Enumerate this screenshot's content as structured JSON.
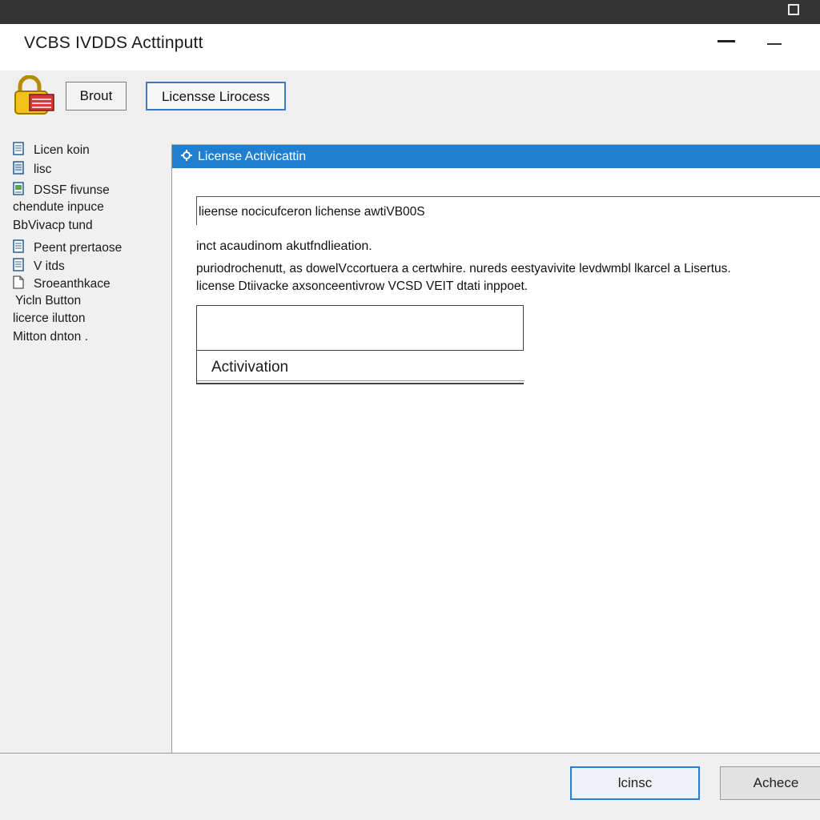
{
  "window": {
    "title": "VCBS IVDDS Acttinputt"
  },
  "toolbar": {
    "brout_label": "Brout",
    "license_process_label": "Licensse Lirocess"
  },
  "sidebar": {
    "items": [
      {
        "label": "Licen koin",
        "icon": "document-icon"
      },
      {
        "label": "lisc",
        "icon": "document-icon"
      },
      {
        "label": "DSSF fivunse",
        "icon": "image-document-icon"
      },
      {
        "label": "chendute inpuce",
        "icon": ""
      },
      {
        "label": "BbVivacp tund",
        "icon": ""
      },
      {
        "label": "Peent prertaose",
        "icon": "document-icon"
      },
      {
        "label": "V itds",
        "icon": "document-icon"
      },
      {
        "label": "Sroeanthkace",
        "icon": "page-icon"
      },
      {
        "label": "Yicln Button",
        "icon": ""
      },
      {
        "label": "licerce ilutton",
        "icon": ""
      },
      {
        "label": "Mitton dnton .",
        "icon": ""
      }
    ]
  },
  "panel": {
    "header": "License Activicattin",
    "desc": "lieense nocicufceron lichense awtiVB00S",
    "para1": "inct acaudinom akutfndlieation.",
    "para2": "puriodrochenutt, as dowelVccortuera a certwhire. nureds eestyavivite levdwmbl lkarcel a Lisertus.",
    "para3": "license Dtiivacke axsonceentivrow VCSD VEIT dtati inppoet.",
    "input_value": "",
    "activation_label": "Activivation"
  },
  "footer": {
    "primary_label": "lcinsc",
    "secondary_label": "Achece"
  },
  "colors": {
    "accent": "#1f7fd0",
    "focus_border": "#3a7dbe",
    "topbar": "#333333"
  }
}
